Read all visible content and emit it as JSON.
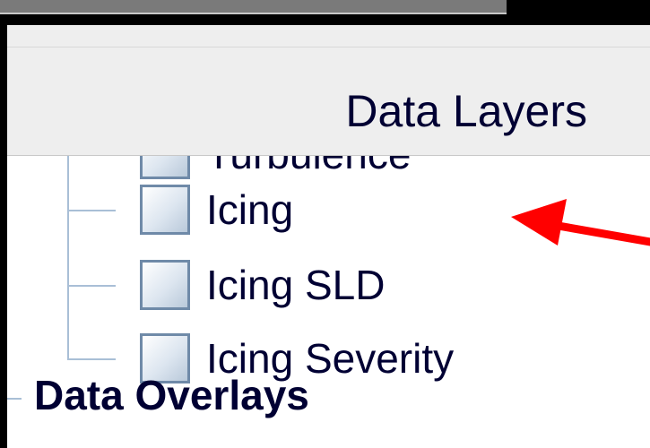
{
  "panel": {
    "title": "Data Layers"
  },
  "layers": [
    {
      "label": "Turbulence",
      "checked": false
    },
    {
      "label": "Icing",
      "checked": false
    },
    {
      "label": "Icing SLD",
      "checked": false
    },
    {
      "label": "Icing Severity",
      "checked": false
    }
  ],
  "overlays": {
    "label": "Data Overlays"
  },
  "colors": {
    "annotation_arrow": "#ff0000",
    "tree_line": "#a9bfd6",
    "text": "#000033"
  }
}
